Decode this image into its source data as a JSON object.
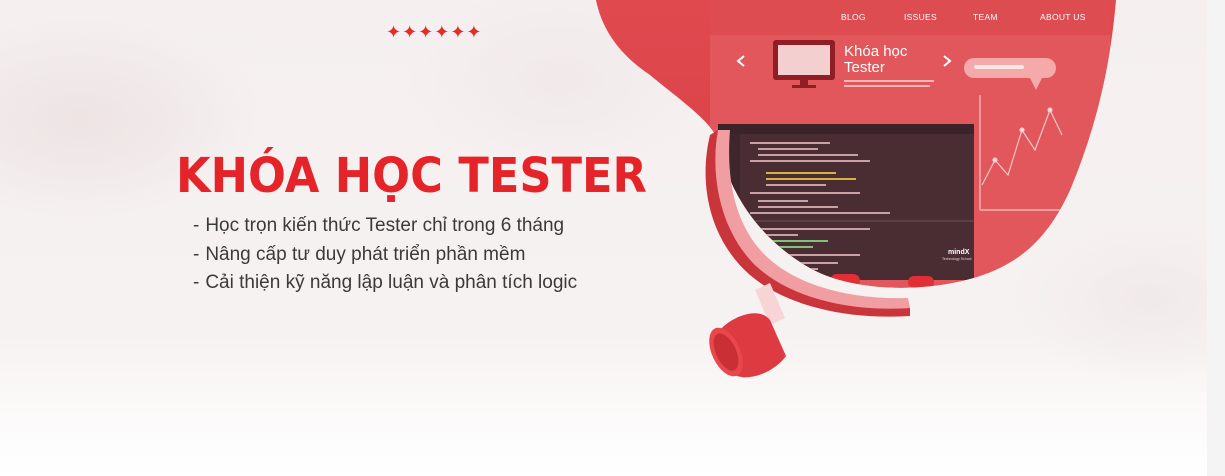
{
  "nav": {
    "items": [
      "BLOG",
      "ISSUES",
      "TEAM",
      "ABOUT US"
    ]
  },
  "decor": {
    "stars": "✦✦✦✦✦✦"
  },
  "hero": {
    "title": "KHÓA HỌC TESTER",
    "bullets": [
      "Học trọn kiến thức Tester chỉ trong 6 tháng",
      "Nâng cấp tư duy phát triển phần mềm",
      "Cải thiện kỹ năng lập luận và phân tích logic"
    ]
  },
  "illustration": {
    "course_title_line1": "Khóa học",
    "course_title_line2": "Tester",
    "watermark_brand": "mindX",
    "watermark_sub": "Technology School"
  },
  "colors": {
    "accent": "#e5242a",
    "blob_red": "#dc4449",
    "text": "#3a3a3a"
  }
}
